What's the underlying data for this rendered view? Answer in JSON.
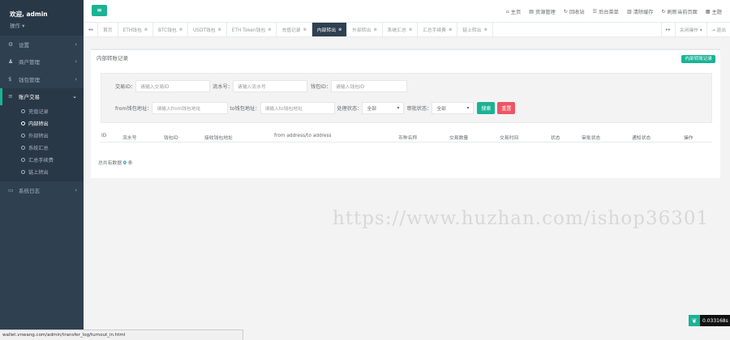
{
  "sidebar": {
    "welcome": "欢迎, admin",
    "ops": "操作 ▾",
    "items": [
      {
        "icon": "gears-icon",
        "glyph": "⚙",
        "label": "设置"
      },
      {
        "icon": "user-icon",
        "glyph": "♟",
        "label": "商户管理"
      },
      {
        "icon": "dollar-icon",
        "glyph": "$",
        "label": "钱包管理"
      },
      {
        "icon": "list-icon",
        "glyph": "≡",
        "label": "账户交易"
      },
      {
        "icon": "desktop-icon",
        "glyph": "▭",
        "label": "系统日志"
      }
    ],
    "sub_items": [
      "充值记录",
      "内部转出",
      "外部转出",
      "系统汇总",
      "汇总手续费",
      "链上转出"
    ]
  },
  "topbar": {
    "menu_glyph": "≡",
    "links": [
      {
        "icon": "home-icon",
        "glyph": "⌂",
        "label": "主页"
      },
      {
        "icon": "file-icon",
        "glyph": "▤",
        "label": "资源管理"
      },
      {
        "icon": "refresh-icon",
        "glyph": "↻",
        "label": "回收站"
      },
      {
        "icon": "menu-icon",
        "glyph": "☰",
        "label": "后台菜单"
      },
      {
        "icon": "trash-icon",
        "glyph": "▥",
        "label": "清除缓存"
      },
      {
        "icon": "reload-icon",
        "glyph": "↻",
        "label": "刷新当前页面"
      },
      {
        "icon": "theme-icon",
        "glyph": "▦",
        "label": "主题"
      }
    ]
  },
  "tabs": {
    "prev": "◂◂",
    "next": "▸▸",
    "close_ops": "关闭操作 ▾",
    "logout": "⇥ 退出",
    "items": [
      "首页",
      "ETH钱包",
      "BTC钱包",
      "USDT钱包",
      "ETH Token钱包",
      "充值记录",
      "内部转出",
      "外部转出",
      "系统汇总",
      "汇总手续费",
      "链上转出"
    ],
    "active_index": 6
  },
  "panel": {
    "title": "内部转账记录",
    "action_button": "内部转账记录",
    "filter": {
      "row1": [
        {
          "label": "交易ID：",
          "placeholder": "请输入交易ID"
        },
        {
          "label": "流水号：",
          "placeholder": "请输入流水号"
        },
        {
          "label": "钱包ID：",
          "placeholder": "请输入钱包ID"
        }
      ],
      "from_label": "from钱包地址：",
      "from_placeholder": "请输入from钱包地址",
      "to_label": "to钱包地址：",
      "to_placeholder": "请输入to钱包地址",
      "process_label": "处理状态：",
      "process_value": "全部",
      "audit_label": "审批状态：",
      "audit_value": "全部",
      "search_button": "搜索",
      "reset_button": "重置"
    },
    "columns": [
      "ID",
      "流水号",
      "钱包ID",
      "接收钱包地址",
      "from address/to address",
      "币种名称",
      "交易数量",
      "交易时间",
      "状态",
      "审批状态",
      "通知状态",
      "操作"
    ],
    "count_prefix": "总共有数据",
    "count_value": "0",
    "count_suffix": "条"
  },
  "watermark": "https://www.huzhan.com/ishop36301",
  "statusbar": "wallet.vnwang.com/admin/transfer_log/turnout_in.html",
  "timer": "0.033168s"
}
